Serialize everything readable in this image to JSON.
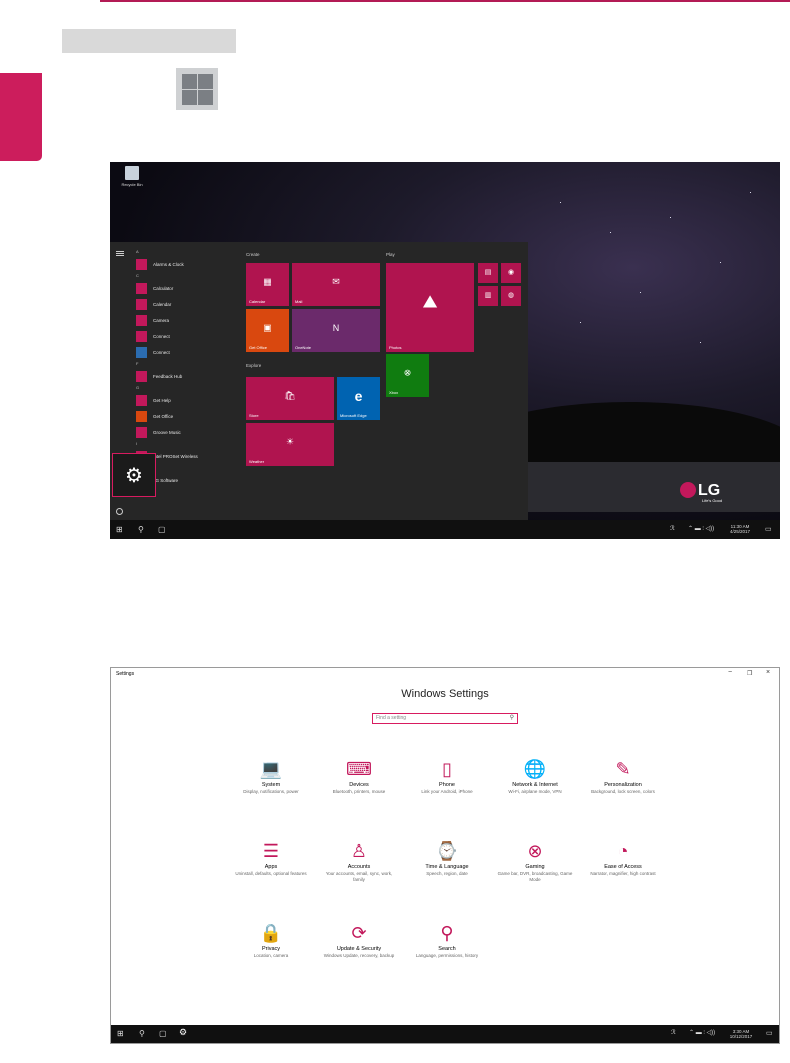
{
  "start_screen": {
    "desktop_icon_label": "Recycle Bin",
    "groups": {
      "create": "Create",
      "play": "Play",
      "explore": "Explore"
    },
    "app_list": [
      {
        "letter": "A",
        "apps": [
          "Alarms & Clock"
        ]
      },
      {
        "letter": "C",
        "apps": [
          "Calculator",
          "Calendar",
          "Camera",
          "Connect",
          "Connect"
        ]
      },
      {
        "letter": "F",
        "apps": [
          "Feedback Hub"
        ]
      },
      {
        "letter": "G",
        "apps": [
          "Get Help",
          "Get Office",
          "Groove Music"
        ]
      },
      {
        "letter": "I",
        "apps": [
          "Intel PROSet Wireless"
        ]
      },
      {
        "letter": "L",
        "apps": [
          "LG Software"
        ]
      }
    ],
    "tiles": {
      "calendar": "Calendar",
      "mail": "Mail",
      "get_office": "Get Office",
      "onenote": "OneNote",
      "photos": "Photos",
      "xbox": "Xbox",
      "store": "Store",
      "edge": "Microsoft Edge",
      "weather": "Weather"
    },
    "brand": {
      "name": "LG",
      "tagline": "Life's Good"
    },
    "clock_time": "11:30 AM",
    "clock_date": "4/25/2017"
  },
  "settings": {
    "window_title": "Settings",
    "heading": "Windows Settings",
    "search_placeholder": "Find a setting",
    "categories": [
      {
        "name": "System",
        "desc": "Display, notifications, power",
        "icon": "laptop-icon"
      },
      {
        "name": "Devices",
        "desc": "Bluetooth, printers, mouse",
        "icon": "devices-icon"
      },
      {
        "name": "Phone",
        "desc": "Link your Android, iPhone",
        "icon": "phone-icon"
      },
      {
        "name": "Network & Internet",
        "desc": "Wi-Fi, airplane mode, VPN",
        "icon": "globe-icon"
      },
      {
        "name": "Personalization",
        "desc": "Background, lock screen, colors",
        "icon": "pen-icon"
      },
      {
        "name": "Apps",
        "desc": "Uninstall, defaults, optional features",
        "icon": "apps-list-icon"
      },
      {
        "name": "Accounts",
        "desc": "Your accounts, email, sync, work, family",
        "icon": "person-icon"
      },
      {
        "name": "Time & Language",
        "desc": "Speech, region, date",
        "icon": "time-language-icon"
      },
      {
        "name": "Gaming",
        "desc": "Game bar, DVR, broadcasting, Game Mode",
        "icon": "xbox-icon"
      },
      {
        "name": "Ease of Access",
        "desc": "Narrator, magnifier, high contrast",
        "icon": "ease-access-icon"
      },
      {
        "name": "Privacy",
        "desc": "Location, camera",
        "icon": "lock-icon"
      },
      {
        "name": "Update & Security",
        "desc": "Windows Update, recovery, backup",
        "icon": "sync-icon"
      },
      {
        "name": "Search",
        "desc": "Language, permissions, history",
        "icon": "search-icon"
      }
    ],
    "clock_time": "3:30 AM",
    "clock_date": "10/12/2017"
  },
  "colors": {
    "accent": "#c2185b",
    "tile": "#b0144f",
    "highlight": "#d81b60",
    "tab": "#cc1d5c"
  }
}
